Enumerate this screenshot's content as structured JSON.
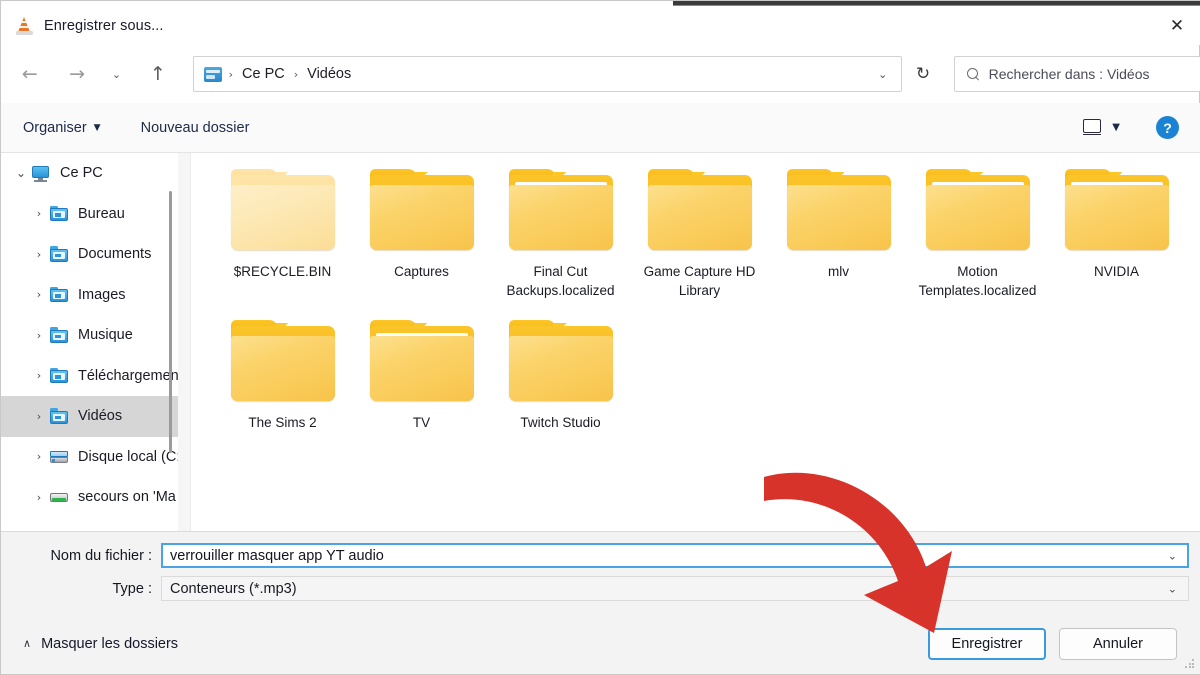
{
  "window": {
    "title": "Enregistrer sous...",
    "app_icon": "vlc-cone-icon",
    "close_label": "✕"
  },
  "navigation": {
    "back": "←",
    "forward": "→",
    "recent": "⌄",
    "up": "↑",
    "refresh": "↻",
    "address_chevron": "⌄",
    "breadcrumb": [
      "Ce PC",
      "Vidéos"
    ],
    "separator": "›"
  },
  "search": {
    "placeholder": "Rechercher dans : Vidéos"
  },
  "toolbar": {
    "organiser_label": "Organiser",
    "organiser_caret": "▼",
    "new_folder_label": "Nouveau dossier",
    "view_caret": "▼",
    "help_label": "?"
  },
  "sidebar": {
    "items": [
      {
        "label": "Ce PC",
        "icon": "pc-icon",
        "chevron": "⌄",
        "expanded": true,
        "selected": false,
        "indent": 0
      },
      {
        "label": "Bureau",
        "icon": "folder-desktop-icon",
        "chevron": "›",
        "expanded": false,
        "selected": false,
        "indent": 1
      },
      {
        "label": "Documents",
        "icon": "folder-documents-icon",
        "chevron": "›",
        "expanded": false,
        "selected": false,
        "indent": 1
      },
      {
        "label": "Images",
        "icon": "folder-pictures-icon",
        "chevron": "›",
        "expanded": false,
        "selected": false,
        "indent": 1
      },
      {
        "label": "Musique",
        "icon": "folder-music-icon",
        "chevron": "›",
        "expanded": false,
        "selected": false,
        "indent": 1
      },
      {
        "label": "Téléchargemen",
        "icon": "folder-downloads-icon",
        "chevron": "›",
        "expanded": false,
        "selected": false,
        "indent": 1
      },
      {
        "label": "Vidéos",
        "icon": "folder-videos-icon",
        "chevron": "›",
        "expanded": false,
        "selected": true,
        "indent": 1
      },
      {
        "label": "Disque local (C:",
        "icon": "disk-icon",
        "chevron": "›",
        "expanded": false,
        "selected": false,
        "indent": 1
      },
      {
        "label": "secours on 'Ma",
        "icon": "network-drive-icon",
        "chevron": "›",
        "expanded": false,
        "selected": false,
        "indent": 1
      }
    ]
  },
  "files": {
    "row1": [
      {
        "name": "$RECYCLE.BIN",
        "style": "pale"
      },
      {
        "name": "Captures",
        "style": "normal-nopaper"
      },
      {
        "name": "Final Cut Backups.localized",
        "style": "normal"
      },
      {
        "name": "Game Capture HD Library",
        "style": "normal-nopaper"
      },
      {
        "name": "mlv",
        "style": "normal-nopaper"
      },
      {
        "name": "Motion Templates.localized",
        "style": "normal"
      },
      {
        "name": "NVIDIA",
        "style": "normal"
      }
    ],
    "row2": [
      {
        "name": "The Sims 2",
        "style": "normal-nopaper"
      },
      {
        "name": "TV",
        "style": "normal"
      },
      {
        "name": "Twitch Studio",
        "style": "normal-nopaper"
      }
    ]
  },
  "form": {
    "filename_label": "Nom du fichier :",
    "filename_value": "verrouiller masquer app YT audio",
    "filetype_label": "Type :",
    "filetype_value": "Conteneurs (*.mp3)",
    "combo_chevron": "⌄"
  },
  "footer": {
    "hide_folders_label": "Masquer les dossiers",
    "hide_folders_caret": "∧",
    "save_label": "Enregistrer",
    "cancel_label": "Annuler"
  },
  "annotation": {
    "arrow_color": "#d8332a",
    "arrow_name": "red-pointer-arrow"
  }
}
